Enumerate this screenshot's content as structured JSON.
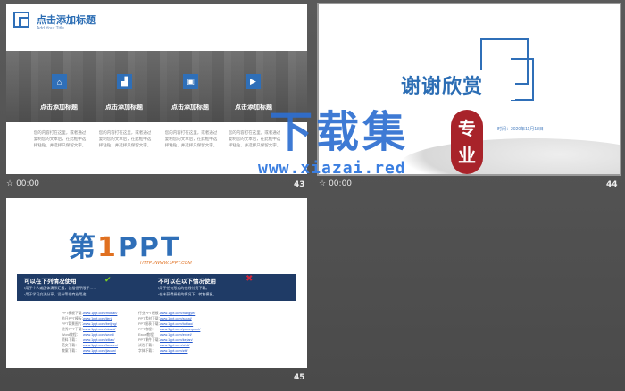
{
  "slides": [
    {
      "number": "43",
      "time": "00:00",
      "title": "点击添加标题",
      "subtitle": "Add Your Title",
      "features": [
        {
          "icon": "home-icon",
          "title": "点击添加标题",
          "text": "您的内容打在这里，或者通过复制您的文本后，在此框中选择粘贴，并选择只保留文字。"
        },
        {
          "icon": "chart-icon",
          "title": "点击添加标题",
          "text": "您的内容打在这里，或者通过复制您的文本后，在此框中选择粘贴，并选择只保留文字。"
        },
        {
          "icon": "briefcase-icon",
          "title": "点击添加标题",
          "text": "您的内容打在这里，或者通过复制您的文本后，在此框中选择粘贴，并选择只保留文字。"
        },
        {
          "icon": "video-icon",
          "title": "点击添加标题",
          "text": "您的内容打在这里，或者通过复制您的文本后，在此框中选择粘贴，并选择只保留文字。"
        }
      ]
    },
    {
      "number": "44",
      "time": "00:00",
      "title": "谢谢欣赏",
      "date_prefix": "20",
      "date": "时间：2020年11月18日"
    },
    {
      "number": "45",
      "logo_a": "第",
      "logo_b": "1",
      "logo_c": "PPT",
      "logo_url": "HTTP://WWW.1PPT.COM",
      "can_use_title": "可以在下列情况使用",
      "can_use_lines": [
        "•用于个人或团体演示汇报，包括但不限于……",
        "•用于学习交流分享、设计等非商业用途……"
      ],
      "cannot_use_title": "不可以在以下情况使用",
      "cannot_use_lines": [
        "•用于任何形式的在线付费下载。",
        "•在未获得授权的情况下，转售模板。"
      ],
      "links_left": [
        {
          "label": "PPT模板下载：",
          "url": "www.1ppt.com/moban/"
        },
        {
          "label": "节日PPT模板：",
          "url": "www.1ppt.com/jieri/"
        },
        {
          "label": "PPT背景图片：",
          "url": "www.1ppt.com/beijing/"
        },
        {
          "label": "优秀PPT下载：",
          "url": "www.1ppt.com/xiazai/"
        },
        {
          "label": "Word教程：",
          "url": "www.1ppt.com/word/"
        },
        {
          "label": "资料下载：",
          "url": "www.1ppt.com/ziliao/"
        },
        {
          "label": "范文下载：",
          "url": "www.1ppt.com/fanwen/"
        },
        {
          "label": "教案下载：",
          "url": "www.1ppt.com/jiaoan/"
        }
      ],
      "links_right": [
        {
          "label": "行业PPT模板：",
          "url": "www.1ppt.com/hangye/"
        },
        {
          "label": "PPT素材下载：",
          "url": "www.1ppt.com/sucai/"
        },
        {
          "label": "PPT图表下载：",
          "url": "www.1ppt.com/tubiao/"
        },
        {
          "label": "PPT教程：",
          "url": "www.1ppt.com/powerpoint/"
        },
        {
          "label": "Excel教程：",
          "url": "www.1ppt.com/excel/"
        },
        {
          "label": "PPT课件下载：",
          "url": "www.1ppt.com/kejian/"
        },
        {
          "label": "试卷下载：",
          "url": "www.1ppt.com/shiti/"
        },
        {
          "label": "字体下载：",
          "url": "www.1ppt.com/ziti/"
        }
      ]
    }
  ],
  "watermark": {
    "text": "下载集",
    "url": "www.xiazai.red",
    "seal": "专业"
  },
  "colors": {
    "accent": "#2f6fb8",
    "navy": "#1f3b66",
    "orange": "#e07020",
    "seal": "#a8232a",
    "background": "#505050"
  }
}
